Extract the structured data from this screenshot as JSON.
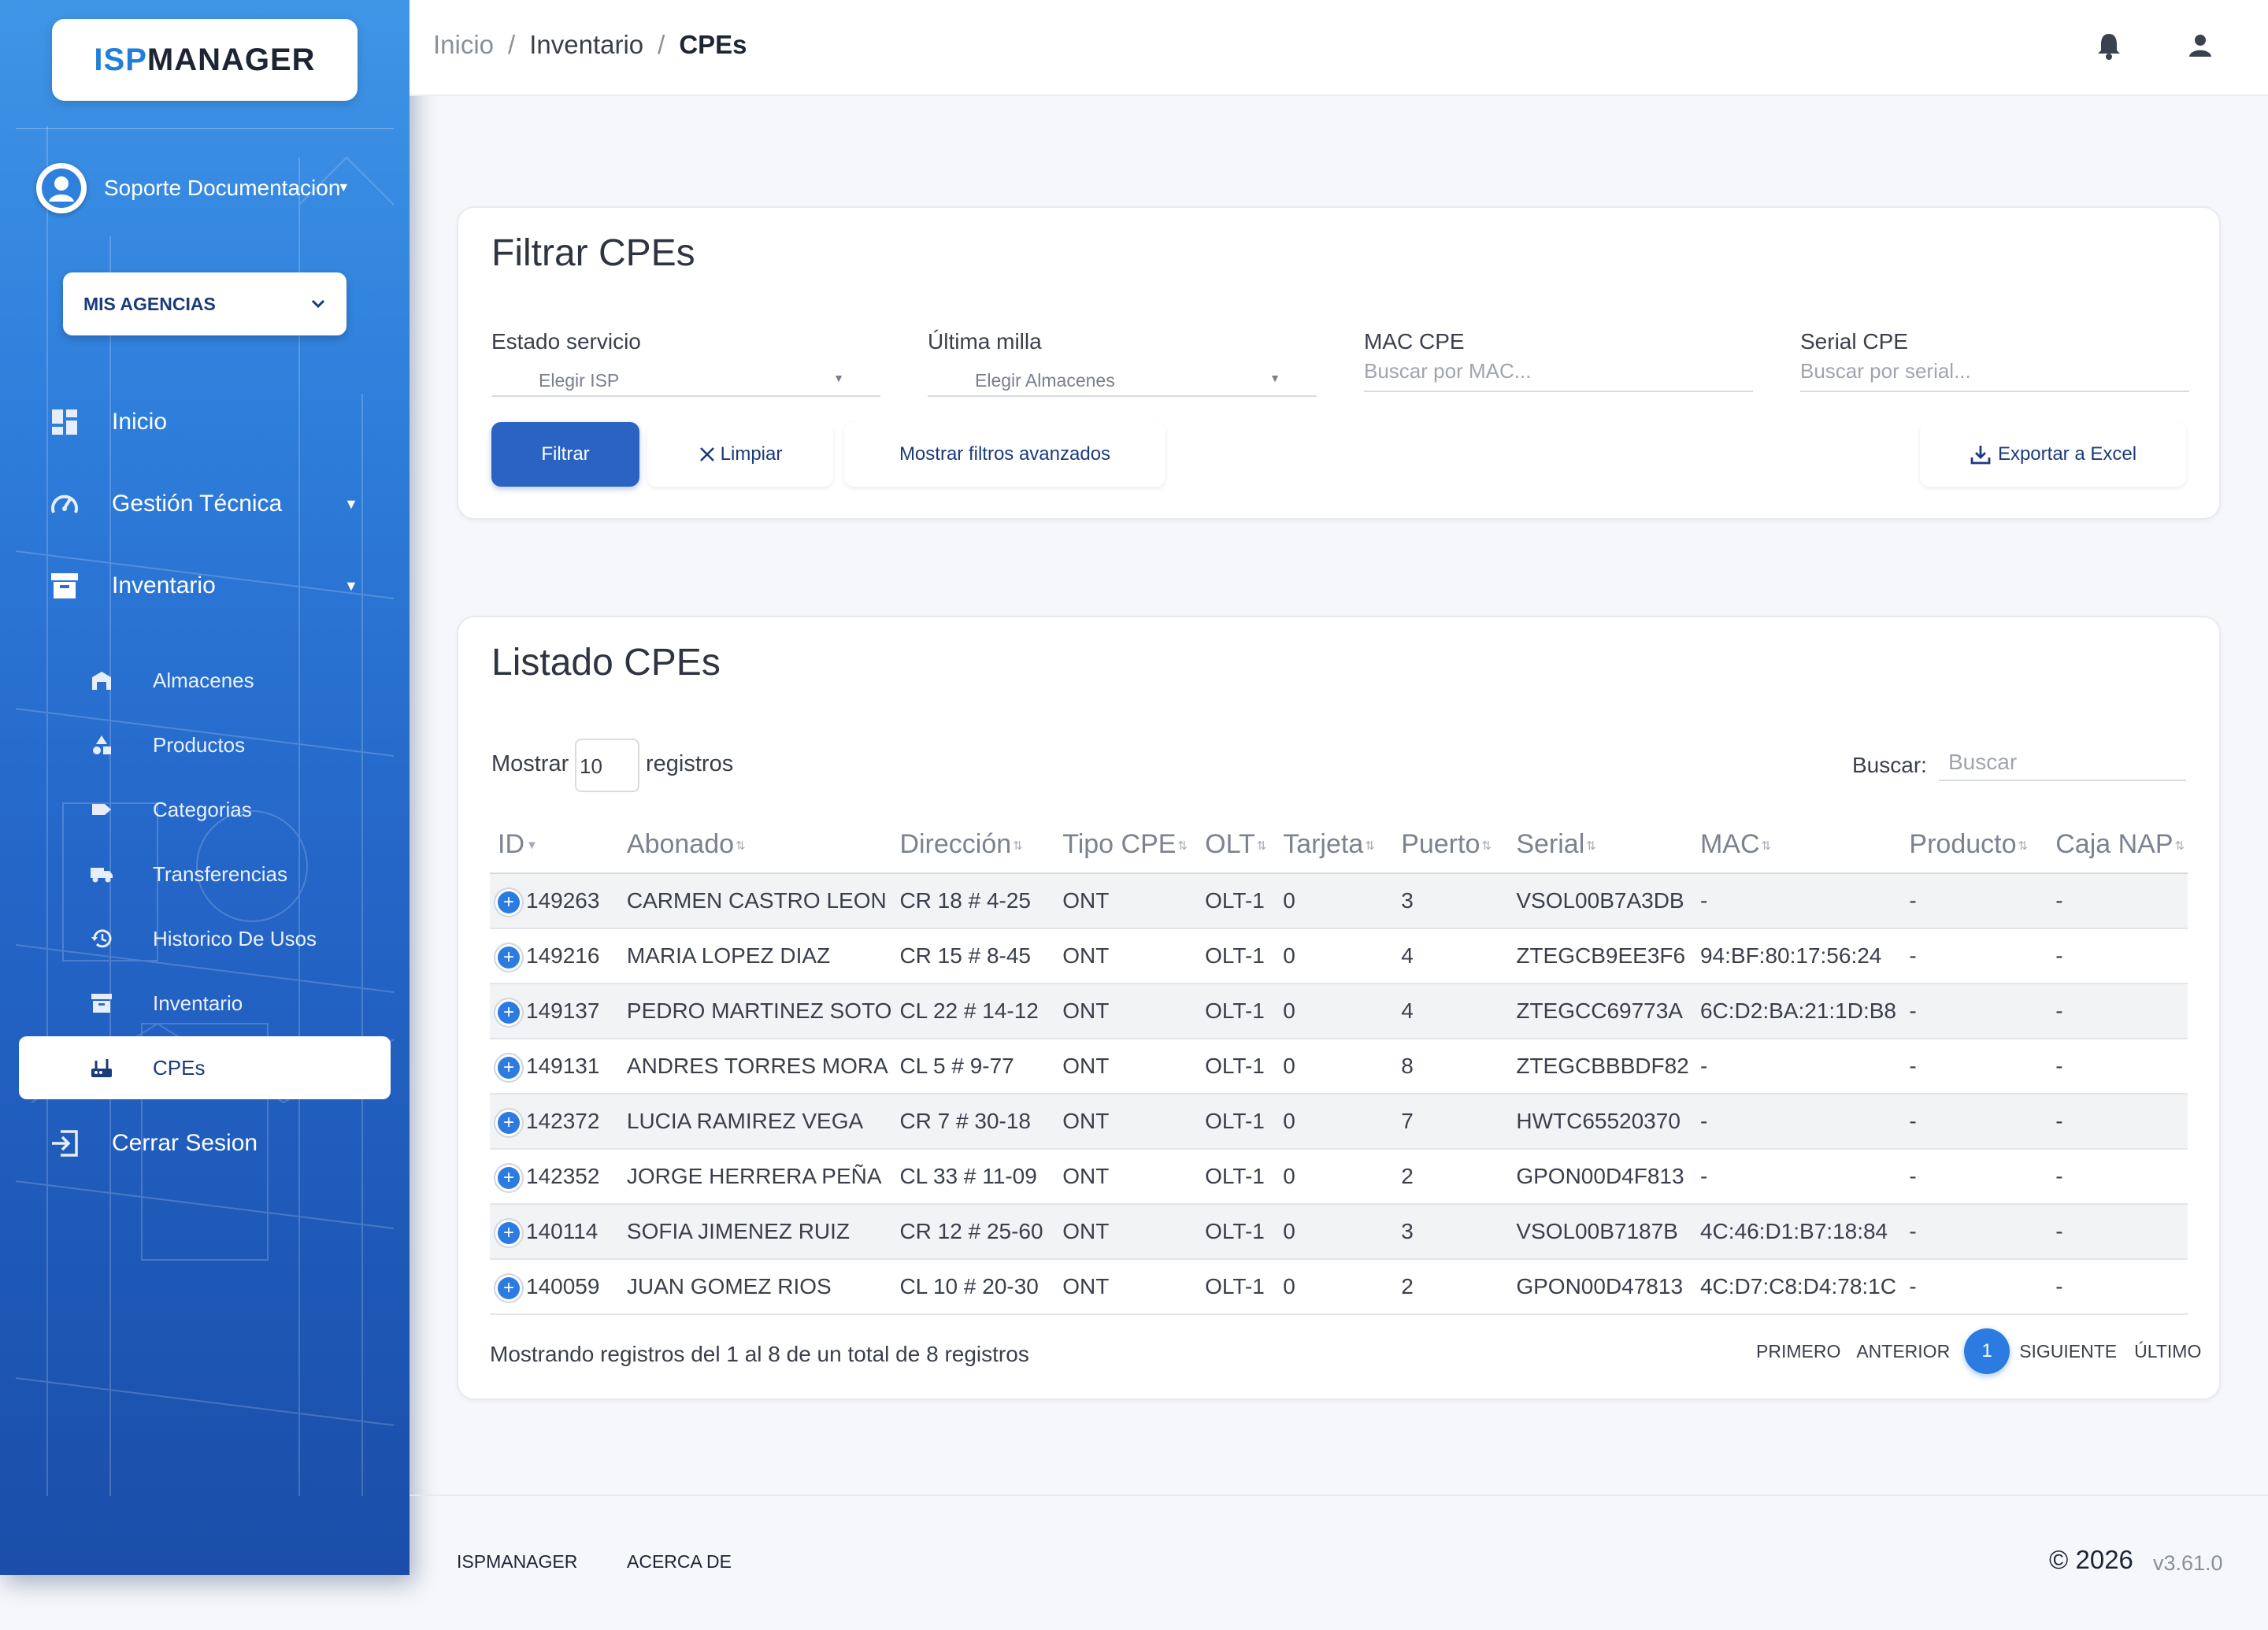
{
  "brand": {
    "isp": "ISP",
    "manager": "MANAGER"
  },
  "user": {
    "name": "Soporte Documentacion"
  },
  "agency": {
    "label": "MIS AGENCIAS"
  },
  "nav": {
    "inicio": "Inicio",
    "gestion": "Gestión Técnica",
    "inventario": "Inventario",
    "sub": [
      "Almacenes",
      "Productos",
      "Categorias",
      "Transferencias",
      "Historico De Usos",
      "Inventario",
      "CPEs"
    ],
    "logout": "Cerrar Sesion"
  },
  "breadcrumb": [
    "Inicio",
    "Inventario",
    "CPEs"
  ],
  "filter": {
    "title": "Filtrar CPEs",
    "estado_label": "Estado servicio",
    "estado_value": "Elegir ISP",
    "milla_label": "Última milla",
    "milla_value": "Elegir Almacenes",
    "mac_label": "MAC CPE",
    "mac_placeholder": "Buscar por MAC...",
    "serial_label": "Serial CPE",
    "serial_placeholder": "Buscar por serial...",
    "btn_filter": "Filtrar",
    "btn_clear": "Limpiar",
    "btn_advanced": "Mostrar filtros avanzados",
    "btn_export": "Exportar a Excel"
  },
  "list": {
    "title": "Listado CPEs",
    "show_prefix": "Mostrar",
    "show_value": "10",
    "show_suffix": "registros",
    "search_label": "Buscar:",
    "search_placeholder": "Buscar",
    "columns": [
      "ID",
      "Abonado",
      "Dirección",
      "Tipo CPE",
      "OLT",
      "Tarjeta",
      "Puerto",
      "Serial",
      "MAC",
      "Producto",
      "Caja NAP"
    ],
    "rows": [
      [
        "149263",
        "CARMEN CASTRO LEON",
        "CR 18 # 4-25",
        "ONT",
        "OLT-1",
        "0",
        "3",
        "VSOL00B7A3DB",
        "-",
        "-",
        "-"
      ],
      [
        "149216",
        "MARIA LOPEZ DIAZ",
        "CR 15 # 8-45",
        "ONT",
        "OLT-1",
        "0",
        "4",
        "ZTEGCB9EE3F6",
        "94:BF:80:17:56:24",
        "-",
        "-"
      ],
      [
        "149137",
        "PEDRO MARTINEZ SOTO",
        "CL 22 # 14-12",
        "ONT",
        "OLT-1",
        "0",
        "4",
        "ZTEGCC69773A",
        "6C:D2:BA:21:1D:B8",
        "-",
        "-"
      ],
      [
        "149131",
        "ANDRES TORRES MORA",
        "CL 5 # 9-77",
        "ONT",
        "OLT-1",
        "0",
        "8",
        "ZTEGCBBBDF82",
        "-",
        "-",
        "-"
      ],
      [
        "142372",
        "LUCIA RAMIREZ VEGA",
        "CR 7 # 30-18",
        "ONT",
        "OLT-1",
        "0",
        "7",
        "HWTC65520370",
        "-",
        "-",
        "-"
      ],
      [
        "142352",
        "JORGE HERRERA PEÑA",
        "CL 33 # 11-09",
        "ONT",
        "OLT-1",
        "0",
        "2",
        "GPON00D4F813",
        "-",
        "-",
        "-"
      ],
      [
        "140114",
        "SOFIA JIMENEZ RUIZ",
        "CR 12 # 25-60",
        "ONT",
        "OLT-1",
        "0",
        "3",
        "VSOL00B7187B",
        "4C:46:D1:B7:18:84",
        "-",
        "-"
      ],
      [
        "140059",
        "JUAN GOMEZ RIOS",
        "CL 10 # 20-30",
        "ONT",
        "OLT-1",
        "0",
        "2",
        "GPON00D47813",
        "4C:D7:C8:D4:78:1C",
        "-",
        "-"
      ]
    ],
    "info": "Mostrando registros del 1 al 8 de un total de 8 registros",
    "pager": {
      "first": "PRIMERO",
      "prev": "ANTERIOR",
      "current": "1",
      "next": "SIGUIENTE",
      "last": "ÚLTIMO"
    }
  },
  "footer": {
    "link1": "ISPMANAGER",
    "link2": "ACERCA DE",
    "copyright": "© 2026",
    "version": "v3.61.0"
  },
  "colors": {
    "primary": "#2b63c2",
    "accent": "#2b7be0",
    "sidebar_top": "#3f95e6",
    "sidebar_bottom": "#1a4ea9"
  }
}
